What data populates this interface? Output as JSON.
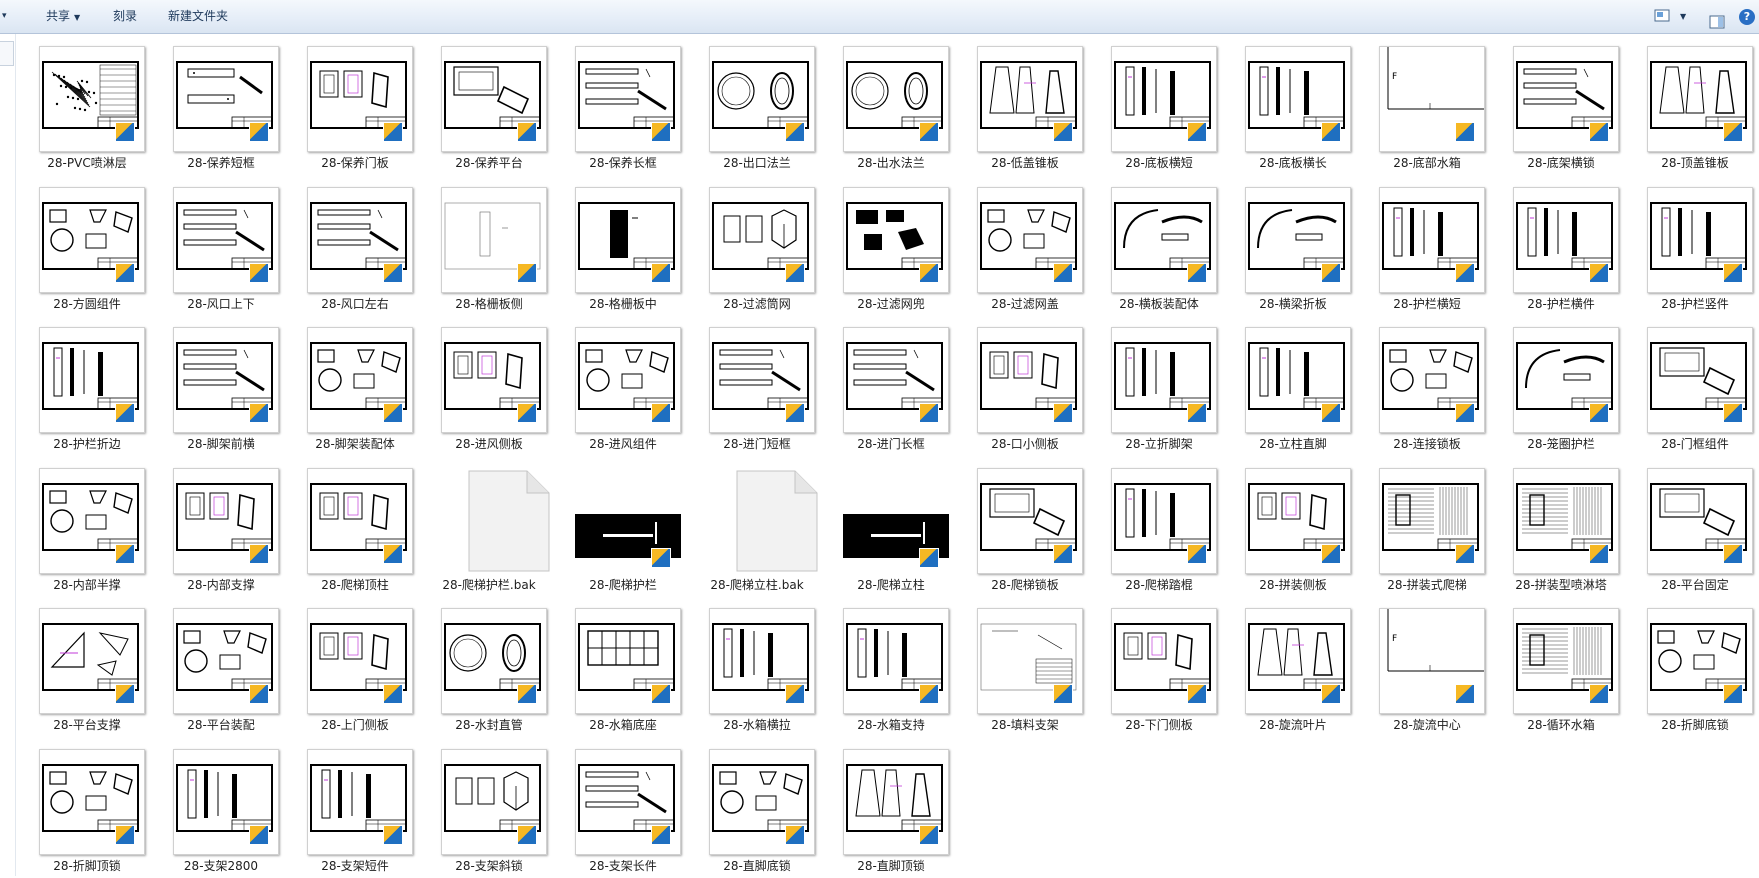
{
  "toolbar": {
    "share_label": "共享",
    "burn_label": "刻录",
    "new_folder_label": "新建文件夹",
    "help_label": "?",
    "views_icon": "view-options-icon",
    "preview_icon": "preview-pane-icon"
  },
  "files": [
    {
      "name": "28-PVC喷淋层",
      "art": "spray"
    },
    {
      "name": "28-保养短框",
      "art": "frames"
    },
    {
      "name": "28-保养门板",
      "art": "doors"
    },
    {
      "name": "28-保养平台",
      "art": "platform"
    },
    {
      "name": "28-保养长框",
      "art": "bars"
    },
    {
      "name": "28-出口法兰",
      "art": "circles",
      "thin": true
    },
    {
      "name": "28-出水法兰",
      "art": "circles"
    },
    {
      "name": "28-低盖锥板",
      "art": "trapezoid"
    },
    {
      "name": "28-底板横短",
      "art": "uprights"
    },
    {
      "name": "28-底板横长",
      "art": "uprights"
    },
    {
      "name": "28-底部水箱",
      "art": "tank",
      "thin": true
    },
    {
      "name": "28-底架横锁",
      "art": "bars"
    },
    {
      "name": "28-顶盖锥板",
      "art": "trapezoid"
    },
    {
      "name": "28-方圆组件",
      "art": "parts"
    },
    {
      "name": "28-风口上下",
      "art": "bars"
    },
    {
      "name": "28-风口左右",
      "art": "bars"
    },
    {
      "name": "28-格栅板侧",
      "art": "grille",
      "thin": true
    },
    {
      "name": "28-格栅板中",
      "art": "grilledark"
    },
    {
      "name": "28-过滤筒网",
      "art": "box3d"
    },
    {
      "name": "28-过滤网兜",
      "art": "darkblocks"
    },
    {
      "name": "28-过滤网盖",
      "art": "parts"
    },
    {
      "name": "28-横板装配体",
      "art": "arc"
    },
    {
      "name": "28-横梁折板",
      "art": "arc"
    },
    {
      "name": "28-护栏横短",
      "art": "uprights"
    },
    {
      "name": "28-护栏横件",
      "art": "uprights"
    },
    {
      "name": "28-护栏竖件",
      "art": "uprights"
    },
    {
      "name": "28-护栏折边",
      "art": "uprights"
    },
    {
      "name": "28-脚架前横",
      "art": "bars"
    },
    {
      "name": "28-脚架装配体",
      "art": "parts"
    },
    {
      "name": "28-进风侧板",
      "art": "doors"
    },
    {
      "name": "28-进风组件",
      "art": "parts"
    },
    {
      "name": "28-进门短框",
      "art": "bars"
    },
    {
      "name": "28-进门长框",
      "art": "bars"
    },
    {
      "name": "28-口小侧板",
      "art": "doors"
    },
    {
      "name": "28-立折脚架",
      "art": "uprights"
    },
    {
      "name": "28-立柱直脚",
      "art": "uprights"
    },
    {
      "name": "28-连接锁板",
      "art": "parts"
    },
    {
      "name": "28-笼圈护栏",
      "art": "arc"
    },
    {
      "name": "28-门框组件",
      "art": "platform"
    },
    {
      "name": "28-内部半撑",
      "art": "parts"
    },
    {
      "name": "28-内部支撑",
      "art": "doors"
    },
    {
      "name": "28-爬梯顶柱",
      "art": "doors"
    },
    {
      "name": "28-爬梯护栏.bak",
      "art": "blank"
    },
    {
      "name": "28-爬梯护栏",
      "art": "darkstrip"
    },
    {
      "name": "28-爬梯立柱.bak",
      "art": "blank"
    },
    {
      "name": "28-爬梯立柱",
      "art": "darkstrip"
    },
    {
      "name": "28-爬梯锁板",
      "art": "platform"
    },
    {
      "name": "28-爬梯踏棍",
      "art": "uprights"
    },
    {
      "name": "28-拼装侧板",
      "art": "doors"
    },
    {
      "name": "28-拼装式爬梯",
      "art": "dense"
    },
    {
      "name": "28-拼装型喷淋塔",
      "art": "dense"
    },
    {
      "name": "28-平台固定",
      "art": "platform"
    },
    {
      "name": "28-平台支撑",
      "art": "triangle"
    },
    {
      "name": "28-平台装配",
      "art": "parts"
    },
    {
      "name": "28-上门侧板",
      "art": "doors"
    },
    {
      "name": "28-水封直管",
      "art": "circles",
      "thin": true
    },
    {
      "name": "28-水箱底座",
      "art": "gridbox"
    },
    {
      "name": "28-水箱横拉",
      "art": "uprights"
    },
    {
      "name": "28-水箱支持",
      "art": "uprights"
    },
    {
      "name": "28-填料支架",
      "art": "sparse",
      "thin": true
    },
    {
      "name": "28-下门侧板",
      "art": "doors"
    },
    {
      "name": "28-旋流叶片",
      "art": "trapezoid"
    },
    {
      "name": "28-旋流中心",
      "art": "tank",
      "thin": true
    },
    {
      "name": "28-循环水箱",
      "art": "dense"
    },
    {
      "name": "28-折脚底锁",
      "art": "parts"
    },
    {
      "name": "28-折脚顶锁",
      "art": "parts"
    },
    {
      "name": "28-支架2800",
      "art": "uprights"
    },
    {
      "name": "28-支架短件",
      "art": "uprights"
    },
    {
      "name": "28-支架斜锁",
      "art": "box3d"
    },
    {
      "name": "28-支架长件",
      "art": "bars"
    },
    {
      "name": "28-直脚底锁",
      "art": "parts"
    },
    {
      "name": "28-直脚顶锁",
      "art": "trapezoid"
    }
  ]
}
